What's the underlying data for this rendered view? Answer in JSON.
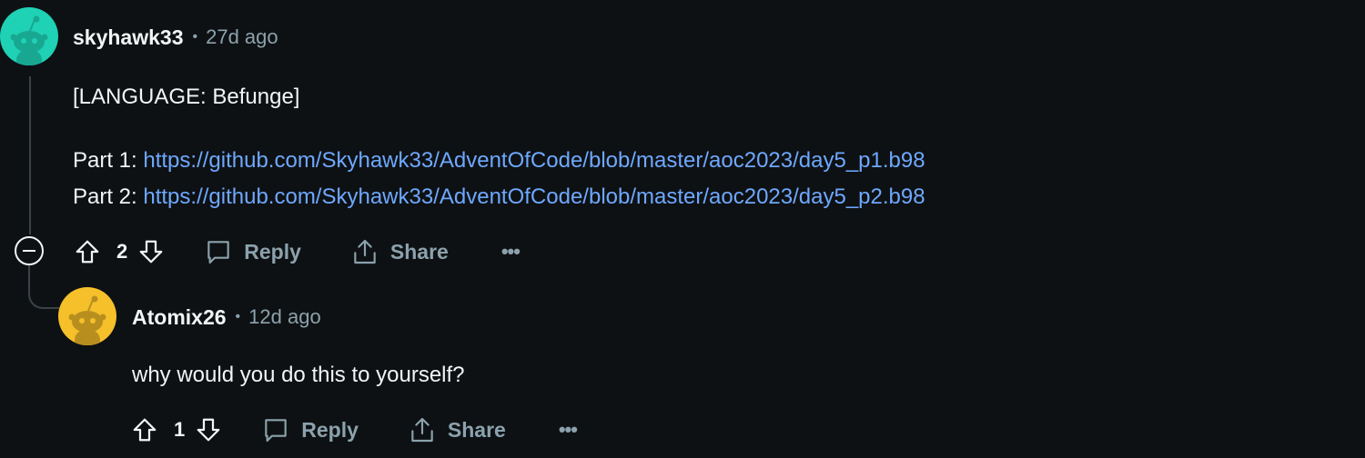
{
  "colors": {
    "background": "#0e1113",
    "text": "#f2f4f5",
    "muted": "#8ba2ad",
    "link": "#6ea8ff",
    "thread_line": "#3a4248",
    "avatar1_bg": "#1fd1b5",
    "avatar2_bg": "#f5c02a"
  },
  "comment": {
    "author": "skyhawk33",
    "separator": "•",
    "time": "27d ago",
    "avatar_icon": "snoo-avatar-icon",
    "body": {
      "language": "[LANGUAGE: Befunge]",
      "part1_label": "Part 1: ",
      "part1_url": "https://github.com/Skyhawk33/AdventOfCode/blob/master/aoc2023/day5_p1.b98",
      "part2_label": "Part 2: ",
      "part2_url": "https://github.com/Skyhawk33/AdventOfCode/blob/master/aoc2023/day5_p2.b98"
    },
    "score": "2",
    "reply_label": "Reply",
    "share_label": "Share",
    "more_label": "•••"
  },
  "reply": {
    "author": "Atomix26",
    "separator": "•",
    "time": "12d ago",
    "avatar_icon": "snoo-avatar-icon",
    "body": "why would you do this to yourself?",
    "score": "1",
    "reply_label": "Reply",
    "share_label": "Share",
    "more_label": "•••"
  }
}
